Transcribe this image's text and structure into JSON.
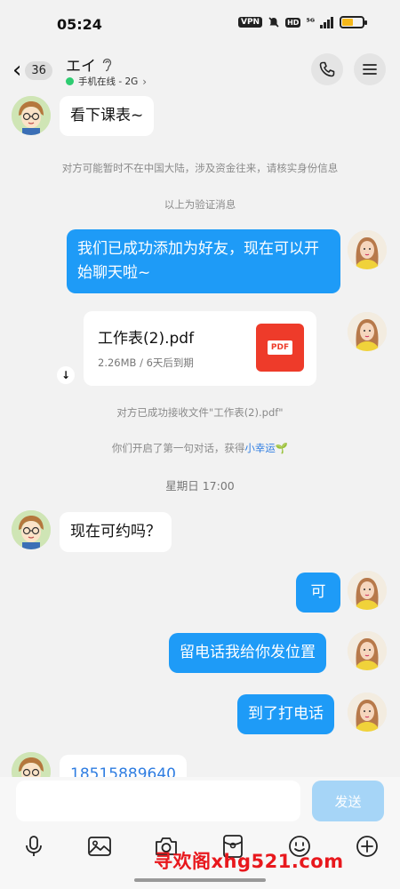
{
  "status_bar": {
    "time": "05:24",
    "vpn": "VPN",
    "hd": "HD",
    "signal": "⁵ᴳ",
    "battery_level": 0.55,
    "battery_color": "#f5b81a"
  },
  "header": {
    "unread_count": "36",
    "contact_name": "エイ",
    "online_status": "手机在线 - 2G",
    "online_color": "#2ecc71"
  },
  "messages": {
    "m1": "看下课表~",
    "sys1": "对方可能暂时不在中国大陆，涉及资金往来，请核实身份信息",
    "sys2": "以上为验证消息",
    "m2": "我们已成功添加为好友，现在可以开始聊天啦~",
    "file": {
      "name": "工作表(2).pdf",
      "meta": "2.26MB / 6天后到期",
      "icon_label": "PDF"
    },
    "sys3": "对方已成功接收文件\"工作表(2).pdf\"",
    "sys4_prefix": "你们开启了第一句对话，获得",
    "sys4_link": "小幸运",
    "sys4_sprout": "🌱",
    "time_divider": "星期日 17:00",
    "m3": "现在可约吗？",
    "m4": "可",
    "m5": "留电话我给你发位置",
    "m6": "到了打电话",
    "m7_partial": "18515889640"
  },
  "input": {
    "placeholder": "",
    "send_label": "发送"
  },
  "toolbar": {
    "icons": [
      "mic-icon",
      "image-icon",
      "camera-icon",
      "red-packet-icon",
      "emoji-icon",
      "plus-icon"
    ]
  },
  "watermark": "寻欢阁xhg521.com",
  "colors": {
    "accent": "#1e9bf7",
    "send_disabled": "#a6d5f7",
    "watermark": "#e8181d"
  }
}
